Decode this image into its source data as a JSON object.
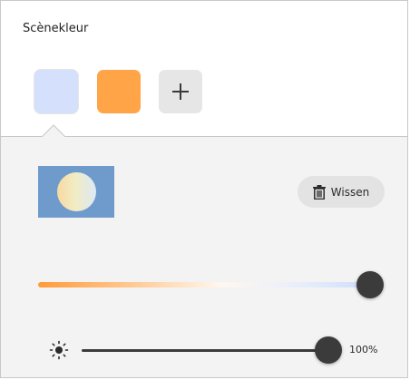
{
  "panel": {
    "title": "Scènekleur"
  },
  "swatches": [
    {
      "name": "swatch-cool-white",
      "color": "#d4e0fc",
      "selected": true
    },
    {
      "name": "swatch-orange",
      "color": "#ffa447",
      "selected": false
    }
  ],
  "add_swatch": {
    "icon": "plus-icon"
  },
  "preview": {
    "background": "#6e9bcc"
  },
  "clear_button": {
    "label": "Wissen",
    "icon": "trash-icon"
  },
  "color_temperature": {
    "value": 1.0,
    "gradient": [
      "#ff9a38",
      "#ffc489",
      "#fff7ef",
      "#e6eefb",
      "#cfdcfc"
    ]
  },
  "brightness": {
    "icon": "sun-icon",
    "value": 100,
    "label": "100%"
  },
  "colors": {
    "slider_thumb": "#3b3b3b",
    "panel_background": "#f3f3f3"
  }
}
